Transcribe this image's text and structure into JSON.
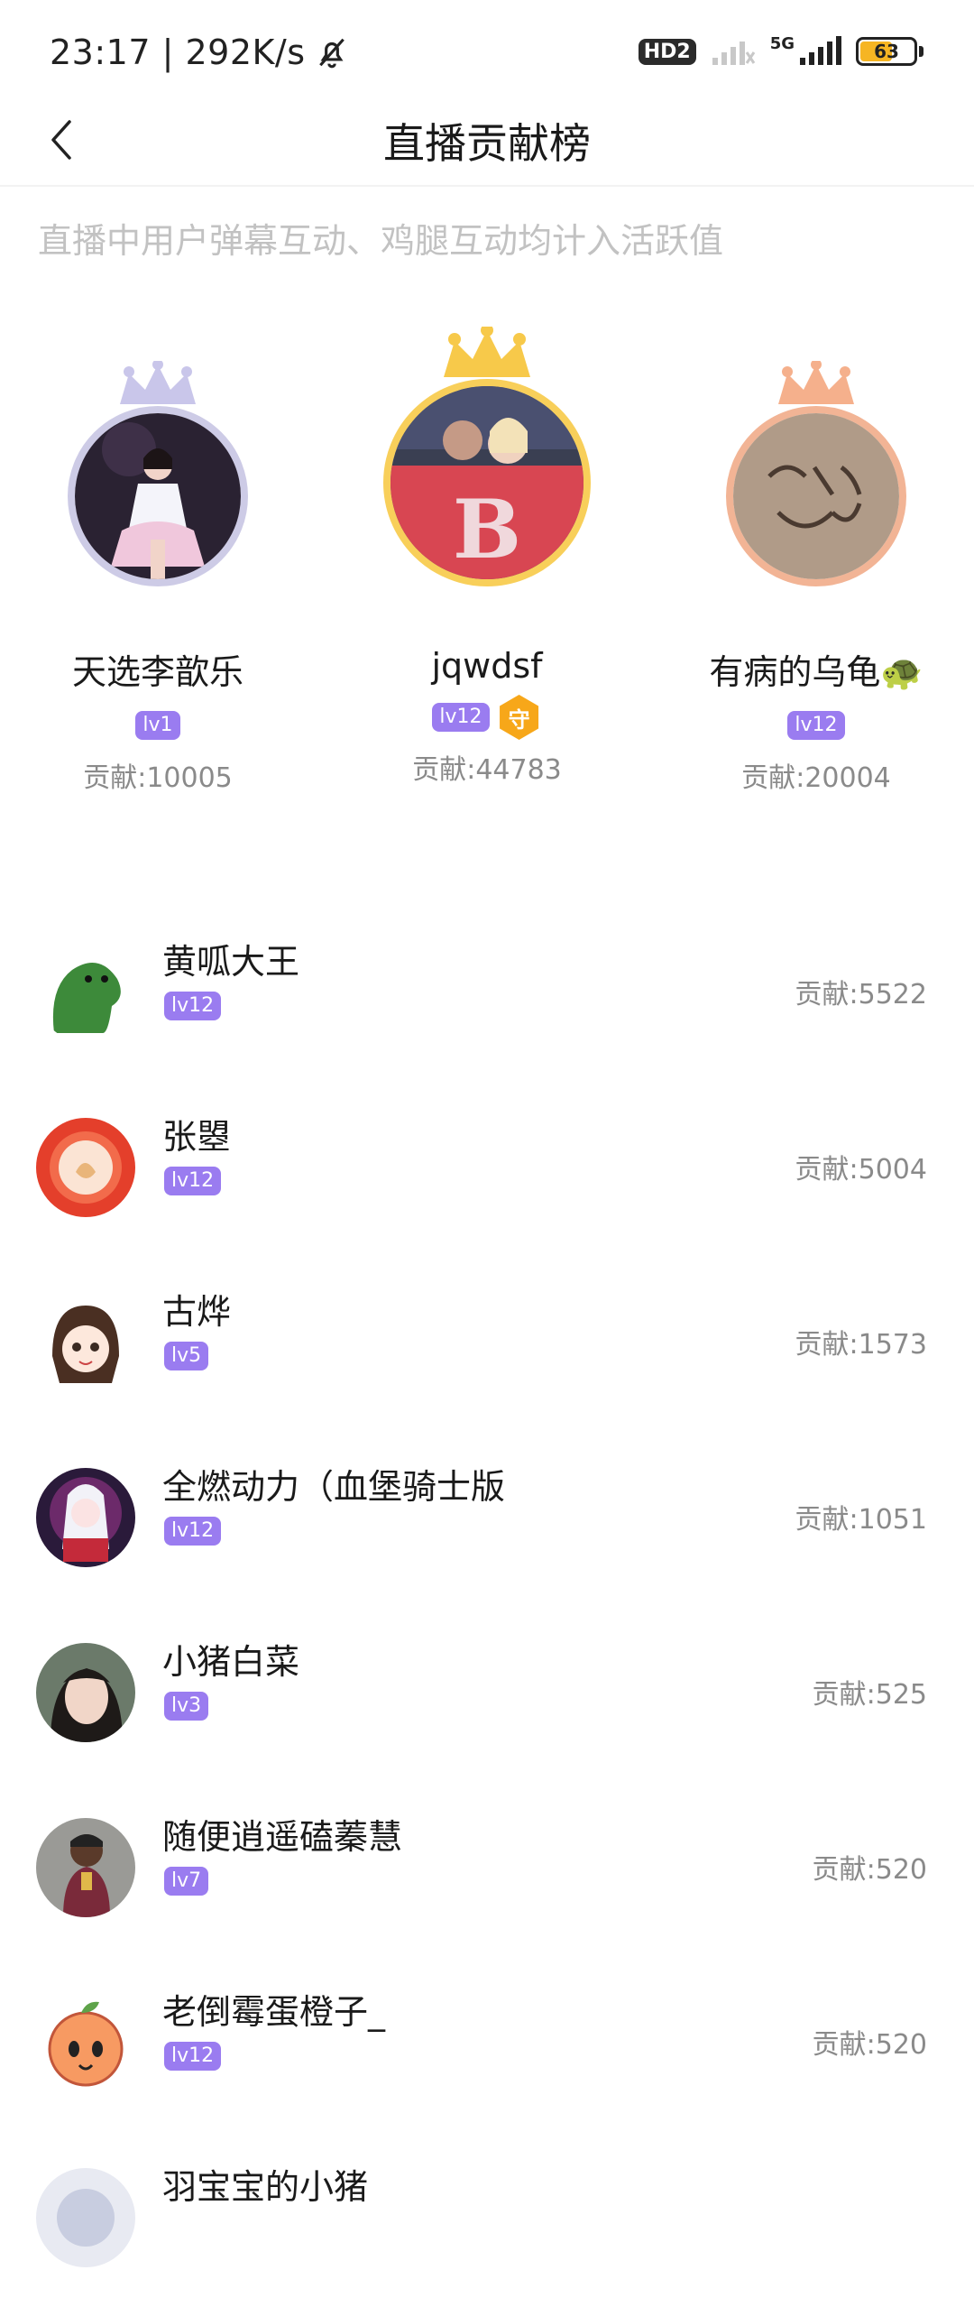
{
  "status": {
    "time_speed": "23:17 | 292K/s",
    "hd": "HD2",
    "network": "5G",
    "battery": "63",
    "battery_level": 0.63
  },
  "nav": {
    "title": "直播贡献榜",
    "back_icon": "chevron-left-icon"
  },
  "notice": "直播中用户弹幕互动、鸡腿互动均计入活跃值",
  "podium": [
    {
      "rank": 2,
      "name": "天选李歆乐",
      "level": "lv1",
      "score": "贡献:10005",
      "crown_color": "#c9c6ea",
      "ring_color": "#cdcbe6"
    },
    {
      "rank": 1,
      "name": "jqwdsf",
      "level": "lv12",
      "guard": "守",
      "score": "贡献:44783",
      "crown_color": "#f7c94a",
      "ring_color": "#f8cf5a"
    },
    {
      "rank": 3,
      "name": "有病的乌龟🐢",
      "level": "lv12",
      "score": "贡献:20004",
      "crown_color": "#f5b08c",
      "ring_color": "#f2b495"
    }
  ],
  "list": [
    {
      "name": "黄呱大王",
      "level": "lv12",
      "score": "贡献:5522"
    },
    {
      "name": "张曌",
      "level": "lv12",
      "score": "贡献:5004"
    },
    {
      "name": "古烨",
      "level": "lv5",
      "score": "贡献:1573"
    },
    {
      "name": "全燃动力（血堡骑士版",
      "level": "lv12",
      "score": "贡献:1051"
    },
    {
      "name": "小猪白菜",
      "level": "lv3",
      "score": "贡献:525"
    },
    {
      "name": "随便逍遥磕蓁慧",
      "level": "lv7",
      "score": "贡献:520"
    },
    {
      "name": "老倒霉蛋橙子_",
      "level": "lv12",
      "score": "贡献:520"
    },
    {
      "name": "羽宝宝的小猪",
      "level": "",
      "score": ""
    }
  ]
}
